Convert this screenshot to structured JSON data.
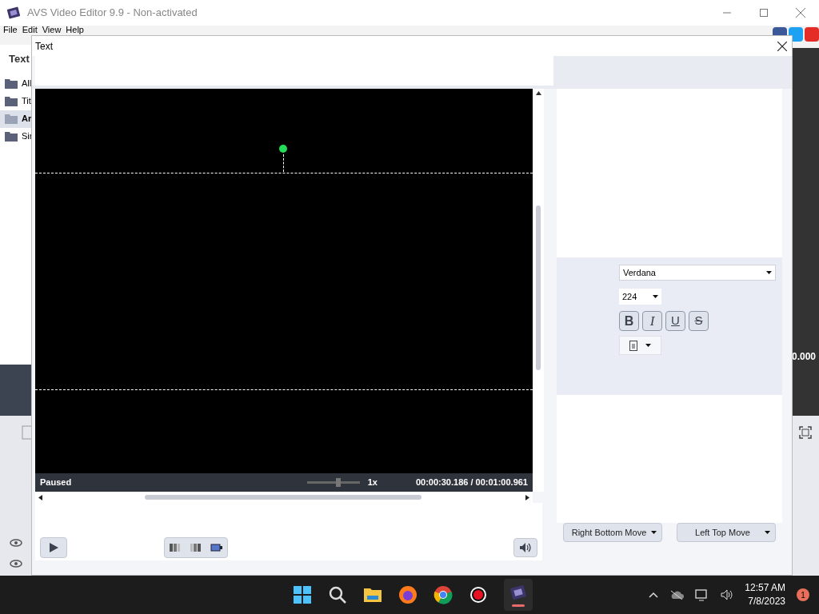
{
  "app": {
    "title": "AVS Video Editor 9.9 - Non-activated",
    "menu": [
      "File",
      "Edit",
      "View",
      "Help"
    ],
    "panel_title": "Text",
    "categories": [
      {
        "label": "All",
        "selected": false
      },
      {
        "label": "Tit",
        "selected": false
      },
      {
        "label": "Ar",
        "selected": true
      },
      {
        "label": "Sir",
        "selected": false
      }
    ],
    "time_fragment": "0.000"
  },
  "dialog": {
    "title": "Text",
    "player": {
      "status": "Paused",
      "speed": "1x",
      "speed_slider": {
        "level": 0.6
      },
      "time": "00:00:30.186 / 00:01:00.961"
    },
    "font": {
      "family": "Verdana",
      "size": "224",
      "styles": [
        {
          "label": "B",
          "kind": "bold"
        },
        {
          "label": "I",
          "kind": "italic"
        },
        {
          "label": "U",
          "kind": "underline"
        },
        {
          "label": "S",
          "kind": "strike"
        }
      ]
    },
    "buttons": [
      "Right Bottom Move",
      "Left Top Move"
    ]
  },
  "taskbar": {
    "time": "12:57 AM",
    "date": "7/8/2023",
    "notifications": "1"
  }
}
